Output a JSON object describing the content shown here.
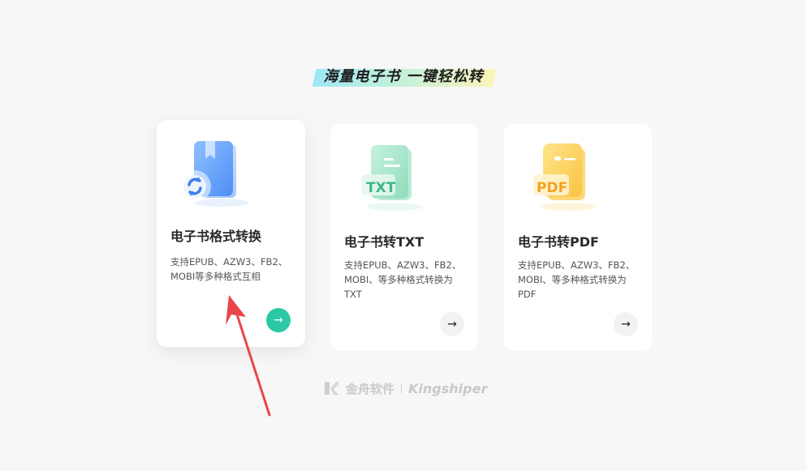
{
  "headline": "海量电子书  一键轻松转",
  "cards": [
    {
      "title": "电子书格式转换",
      "desc": "支持EPUB、AZW3、FB2、MOBI等多种格式互相",
      "icon": "book-convert-icon",
      "button": "→"
    },
    {
      "title": "电子书转TXT",
      "desc": "支持EPUB、AZW3、FB2、MOBI、等多种格式转换为TXT",
      "icon": "txt-doc-icon",
      "icon_label": "TXT",
      "button": "→"
    },
    {
      "title": "电子书转PDF",
      "desc": "支持EPUB、AZW3、FB2、MOBI、等多种格式转换为PDF",
      "icon": "pdf-doc-icon",
      "icon_label": "PDF",
      "button": "→"
    }
  ],
  "brand": {
    "cn": "金舟软件",
    "en": "Kingshiper"
  },
  "colors": {
    "accent": "#2bc9a6",
    "annotation": "#e8474a"
  }
}
